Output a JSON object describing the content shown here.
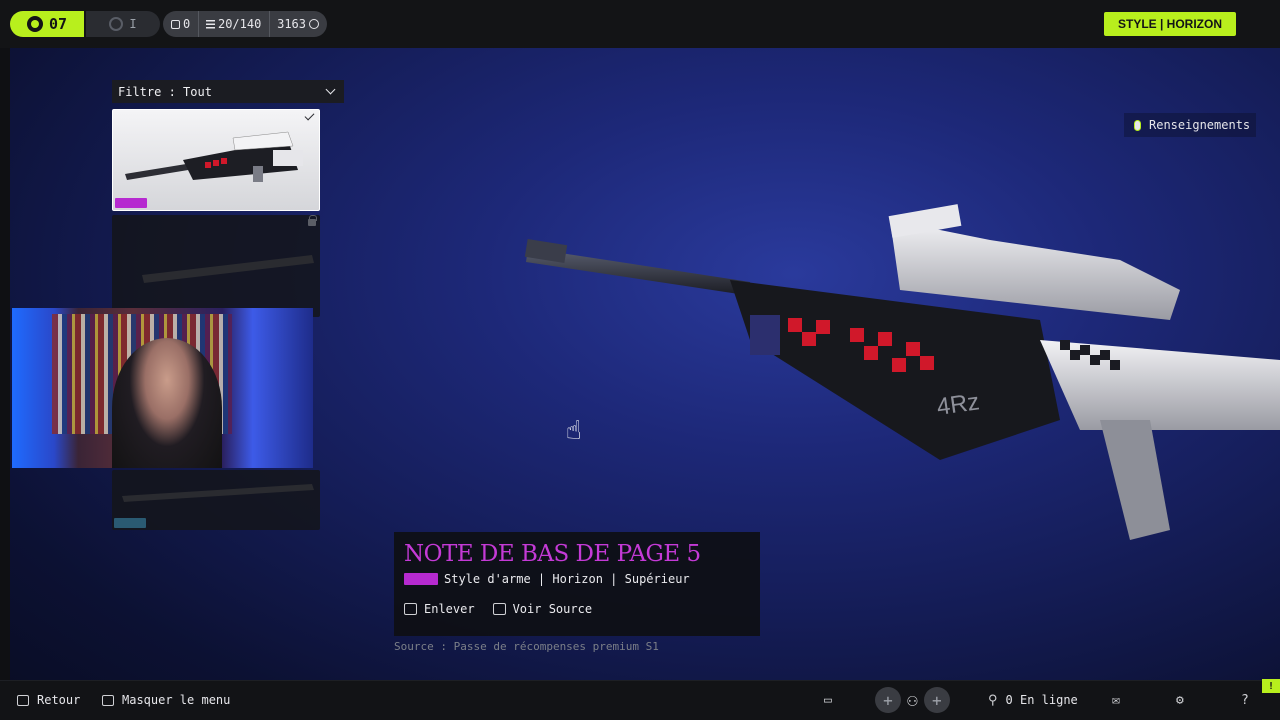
{
  "hud": {
    "level": "07",
    "rank": "I",
    "stat_a": "0",
    "stat_b": "20/140",
    "currency": "3163"
  },
  "style_badge": "STYLE | HORIZON",
  "info_button": "Renseignements",
  "filter": {
    "label": "Filtre : Tout"
  },
  "item": {
    "name": "NOTE DE BAS DE PAGE 5",
    "type_line": "Style d'arme | Horizon | Supérieur",
    "remove_label": "Enlever",
    "view_source_label": "Voir Source",
    "source": "Source : Passe de récompenses premium S1"
  },
  "bottom": {
    "back": "Retour",
    "hide_menu": "Masquer le menu",
    "online": "0 En ligne"
  },
  "colors": {
    "accent": "#b8ef1d",
    "rarity": "#c43ad6",
    "background": "#1d2878"
  },
  "icons": [
    "controller-icon",
    "rank-icon",
    "box-icon",
    "list-icon",
    "coin-icon",
    "mouse-icon",
    "chevron-down-icon",
    "check-icon",
    "lock-icon",
    "hand-cursor-icon",
    "esc-key-icon",
    "key-icon",
    "chat-icon",
    "plus-icon",
    "squad-icon",
    "friends-icon",
    "mail-icon",
    "gear-icon",
    "help-icon"
  ]
}
